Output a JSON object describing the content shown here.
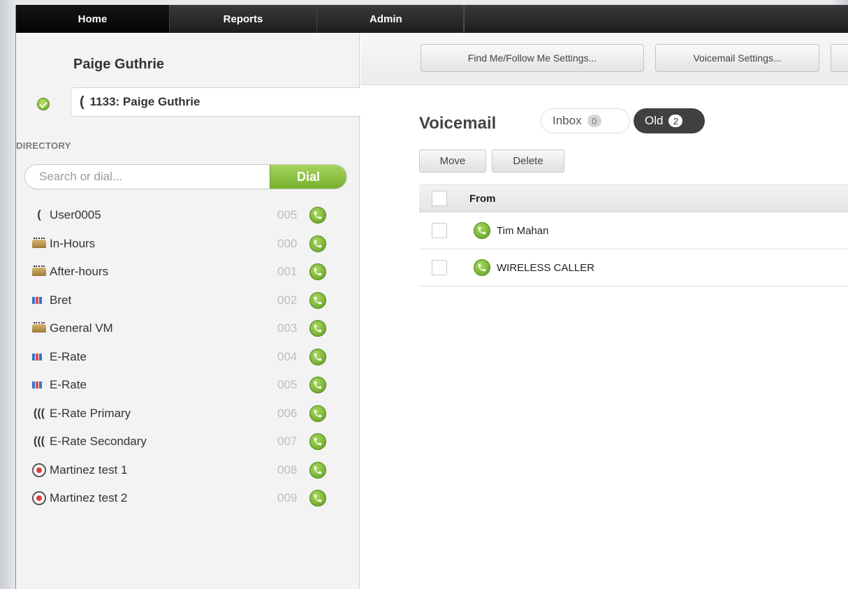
{
  "nav": {
    "tabs": [
      {
        "label": "Home",
        "active": true
      },
      {
        "label": "Reports",
        "active": false
      },
      {
        "label": "Admin",
        "active": false
      }
    ]
  },
  "sidebar": {
    "user_name": "Paige Guthrie",
    "extension": "1133: Paige Guthrie",
    "directory_label": "DIRECTORY",
    "search": {
      "placeholder": "Search or dial...",
      "value": ""
    },
    "dial_label": "Dial",
    "items": [
      {
        "name": "User0005",
        "number": "005",
        "icon": "phone-handset-icon"
      },
      {
        "name": "In-Hours",
        "number": "000",
        "icon": "voicemail-box-icon"
      },
      {
        "name": "After-hours",
        "number": "001",
        "icon": "voicemail-box-icon"
      },
      {
        "name": "Bret",
        "number": "002",
        "icon": "ring-group-icon"
      },
      {
        "name": "General VM",
        "number": "003",
        "icon": "voicemail-box-icon"
      },
      {
        "name": "E-Rate",
        "number": "004",
        "icon": "ring-group-icon"
      },
      {
        "name": "E-Rate",
        "number": "005",
        "icon": "ring-group-icon"
      },
      {
        "name": "E-Rate Primary",
        "number": "006",
        "icon": "hunt-group-icon"
      },
      {
        "name": "E-Rate Secondary",
        "number": "007",
        "icon": "hunt-group-icon"
      },
      {
        "name": "Martinez test 1",
        "number": "008",
        "icon": "conference-icon"
      },
      {
        "name": "Martinez test 2",
        "number": "009",
        "icon": "conference-icon"
      }
    ]
  },
  "toolbar": {
    "find_me_label": "Find Me/Follow Me Settings...",
    "voicemail_settings_label": "Voicemail Settings..."
  },
  "voicemail": {
    "title": "Voicemail",
    "inbox_label": "Inbox",
    "inbox_count": "0",
    "old_label": "Old",
    "old_count": "2",
    "move_label": "Move",
    "delete_label": "Delete",
    "column_from": "From",
    "rows": [
      {
        "from": "Tim Mahan"
      },
      {
        "from": "WIRELESS CALLER"
      }
    ]
  },
  "colors": {
    "accent_green": "#76b22b",
    "nav_dark": "#1e1e1e"
  }
}
